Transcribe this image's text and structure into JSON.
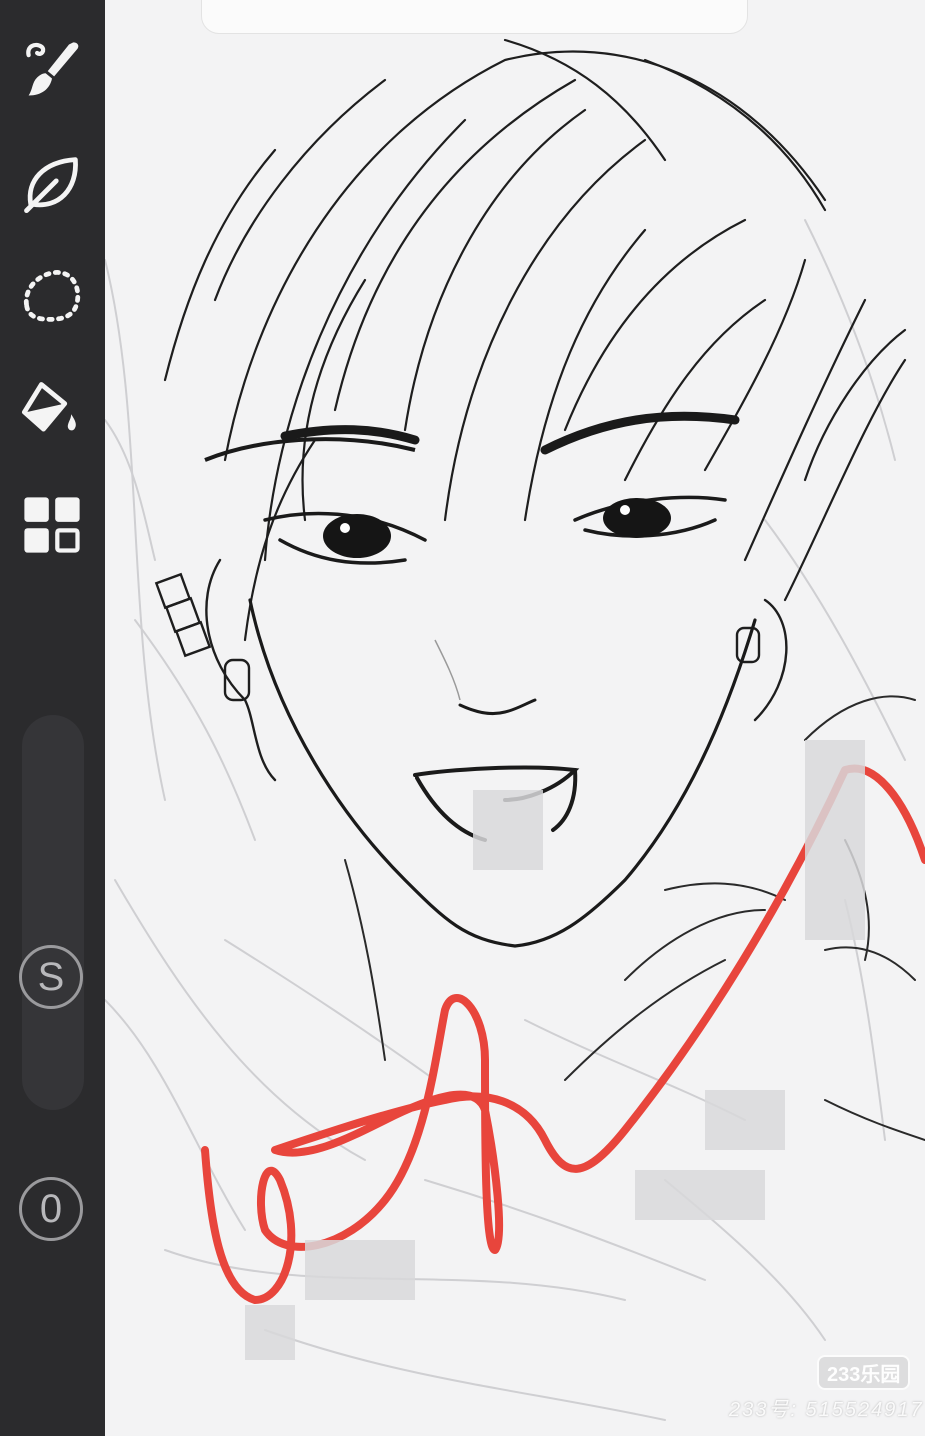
{
  "toolbar": {
    "tools": [
      {
        "name": "brush",
        "icon": "paintbrush-icon"
      },
      {
        "name": "smudge",
        "icon": "leaf-icon"
      },
      {
        "name": "selection",
        "icon": "lasso-icon"
      },
      {
        "name": "fill",
        "icon": "paint-bucket-icon"
      },
      {
        "name": "layers",
        "icon": "layers-grid-icon"
      }
    ],
    "size_button_label": "S",
    "opacity_button_label": "0"
  },
  "colors": {
    "sidebar": "#2b2b2d",
    "canvas": "#f3f3f4",
    "ink": "#1a1a1a",
    "sketch": "#c9c9cc",
    "annotation": "#e8453c"
  },
  "watermark": {
    "badge": "233乐园",
    "id": "233号: 515524917"
  }
}
